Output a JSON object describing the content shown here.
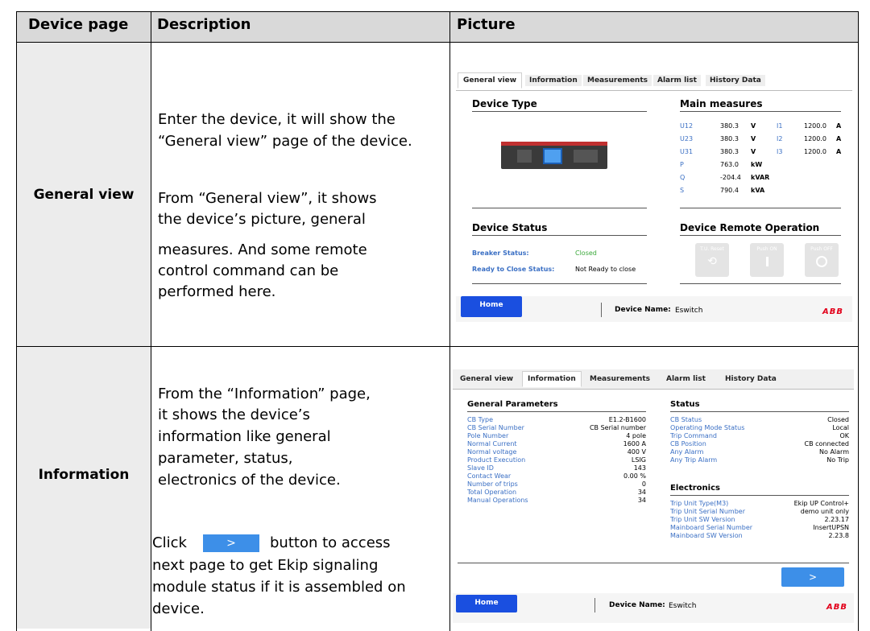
{
  "table": {
    "headers": [
      "Device page",
      "Description",
      "Picture"
    ],
    "rows": [
      {
        "label": "General view",
        "description": [
          "Enter the device, it will show the",
          "“General view” page of the device.",
          "From “General view”, it shows",
          "the device’s picture, general",
          "measures. And some remote",
          "control command can be",
          "performed here."
        ]
      },
      {
        "label": "Information",
        "description": [
          "From the “Information” page,",
          "it shows the device’s",
          "information like general",
          "parameter, status,",
          "electronics of the device."
        ],
        "click_prefix": "Click",
        "click_button_glyph": ">",
        "click_suffix": "button to access",
        "click_lines": [
          "next page to get Ekip signaling",
          "module status if it is assembled on",
          "device."
        ]
      }
    ]
  },
  "general_view_shot": {
    "tabs": [
      "General view",
      "Information",
      "Measurements",
      "Alarm list",
      "History Data"
    ],
    "active_tab": "General view",
    "device_type_title": "Device Type",
    "main_measures_title": "Main measures",
    "measures": [
      {
        "l": "U12",
        "v": "380.3",
        "u": "V",
        "l2": "I1",
        "v2": "1200.0",
        "u2": "A"
      },
      {
        "l": "U23",
        "v": "380.3",
        "u": "V",
        "l2": "I2",
        "v2": "1200.0",
        "u2": "A"
      },
      {
        "l": "U31",
        "v": "380.3",
        "u": "V",
        "l2": "I3",
        "v2": "1200.0",
        "u2": "A"
      },
      {
        "l": "P",
        "v": "763.0",
        "u": "kW",
        "l2": "",
        "v2": "",
        "u2": ""
      },
      {
        "l": "Q",
        "v": "-204.4",
        "u": "kVAR",
        "l2": "",
        "v2": "",
        "u2": ""
      },
      {
        "l": "S",
        "v": "790.4",
        "u": "kVA",
        "l2": "",
        "v2": "",
        "u2": ""
      }
    ],
    "device_status_title": "Device Status",
    "breaker_status_label": "Breaker Status:",
    "breaker_status_value": "Closed",
    "ready_label": "Ready to Close Status:",
    "ready_value": "Not Ready to close",
    "remote_title": "Device Remote Operation",
    "ops": [
      {
        "label": "T.U. Reset",
        "icon": "reset-icon"
      },
      {
        "label": "Push ON",
        "icon": "on-icon"
      },
      {
        "label": "Push OFF",
        "icon": "off-icon"
      }
    ],
    "home_label": "Home",
    "device_name_label": "Device Name:",
    "device_name_value": "Eswitch",
    "logo": "ABB"
  },
  "information_shot": {
    "tabs": [
      "General view",
      "Information",
      "Measurements",
      "Alarm list",
      "History Data"
    ],
    "active_tab": "Information",
    "general_params_title": "General Parameters",
    "general_params": [
      {
        "k": "CB Type",
        "v": "E1.2-B1600"
      },
      {
        "k": "CB Serial Number",
        "v": "CB Serial number"
      },
      {
        "k": "Pole Number",
        "v": "4 pole"
      },
      {
        "k": "Normal Current",
        "v": "1600 A"
      },
      {
        "k": "Normal voltage",
        "v": "400 V"
      },
      {
        "k": "Product Execution",
        "v": "LSIG"
      },
      {
        "k": "Slave ID",
        "v": "143"
      },
      {
        "k": "Contact Wear",
        "v": "0.00 %"
      },
      {
        "k": "Number of trips",
        "v": "0"
      },
      {
        "k": "Total Operation",
        "v": "34"
      },
      {
        "k": "Manual Operations",
        "v": "34"
      }
    ],
    "status_title": "Status",
    "status": [
      {
        "k": "CB Status",
        "v": "Closed"
      },
      {
        "k": "Operating Mode Status",
        "v": "Local"
      },
      {
        "k": "Trip Command",
        "v": "OK"
      },
      {
        "k": "CB Position",
        "v": "CB connected"
      },
      {
        "k": "Any Alarm",
        "v": "No Alarm"
      },
      {
        "k": "Any Trip Alarm",
        "v": "No Trip"
      }
    ],
    "electronics_title": "Electronics",
    "electronics": [
      {
        "k": "Trip Unit Type(M3)",
        "v": "Ekip UP Control+"
      },
      {
        "k": "Trip Unit Serial Number",
        "v": "demo unit only"
      },
      {
        "k": "Trip Unit SW Version",
        "v": "2.23.17"
      },
      {
        "k": "Mainboard Serial Number",
        "v": "InsertUPSN"
      },
      {
        "k": "Mainboard SW Version",
        "v": "2.23.8"
      }
    ],
    "next_glyph": ">",
    "home_label": "Home",
    "device_name_label": "Device Name:",
    "device_name_value": "Eswitch",
    "logo": "ABB"
  }
}
